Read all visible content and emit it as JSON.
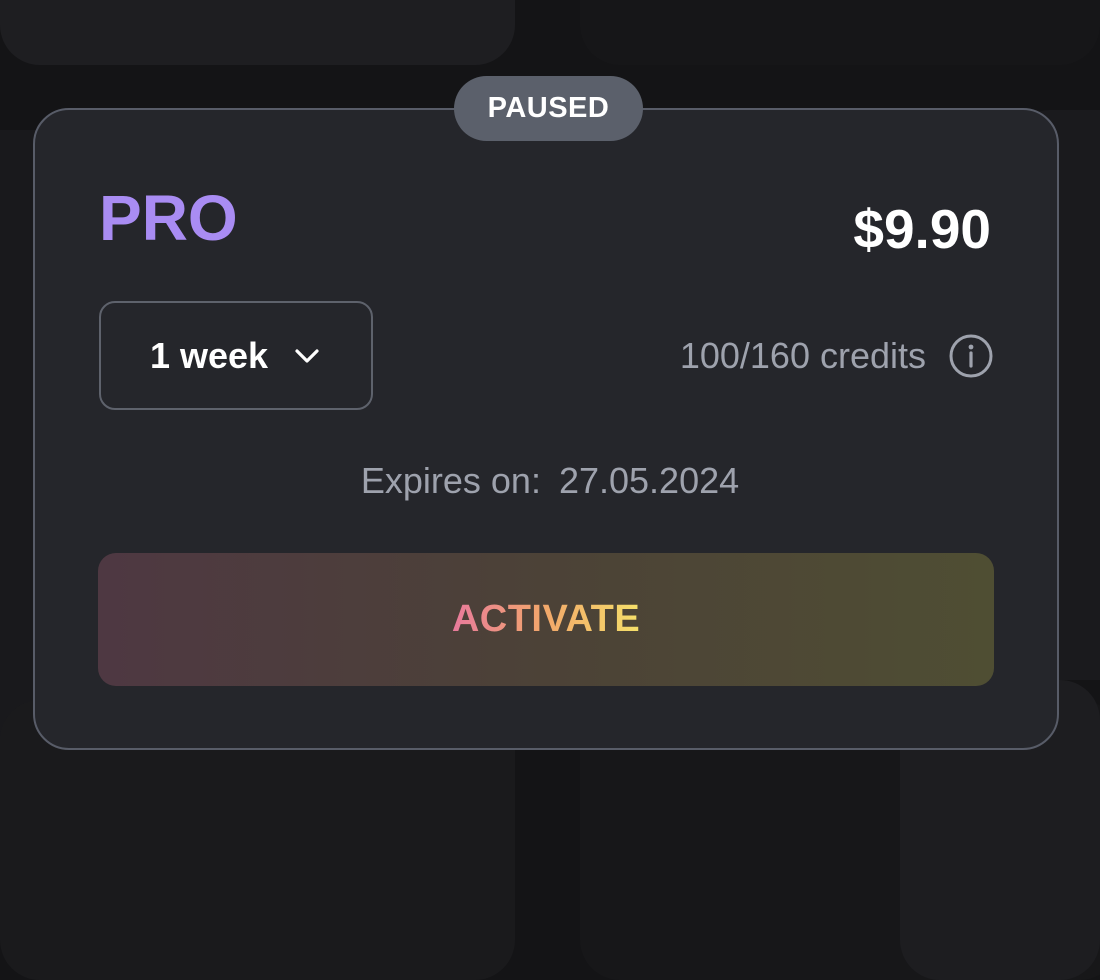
{
  "plan_card": {
    "status_badge": "PAUSED",
    "plan_name": "PRO",
    "price": "$9.90",
    "period_select": {
      "selected": "1 week"
    },
    "credits": "100/160 credits",
    "expires_label": "Expires on:",
    "expires_date": "27.05.2024",
    "activate_label": "ACTIVATE"
  },
  "icons": {
    "period_dropdown": "chevron-down-icon",
    "credits_info": "info-icon"
  },
  "colors": {
    "plan_accent": "#a98cf3",
    "card_background": "#25262b",
    "badge_background": "#5b606b",
    "activate_gradient_start": "#e87a9c",
    "activate_gradient_end": "#f5e06a"
  }
}
